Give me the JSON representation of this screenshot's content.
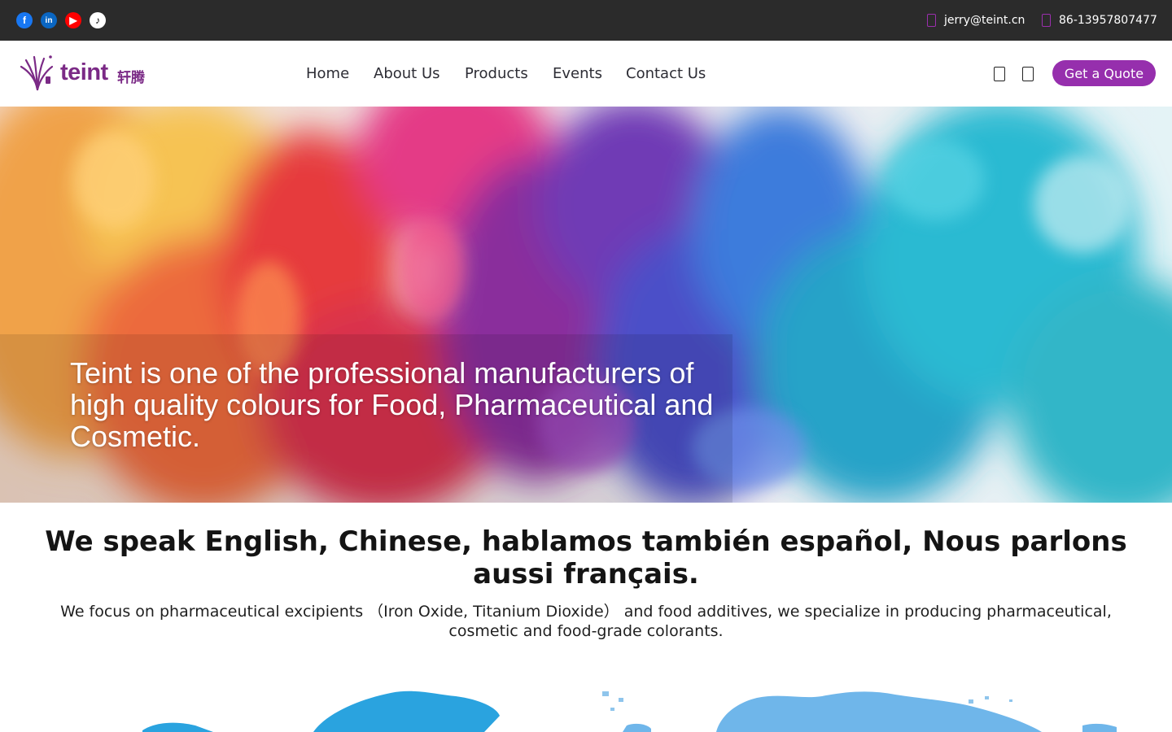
{
  "topbar": {
    "social": [
      {
        "name": "facebook-icon",
        "glyph": "f"
      },
      {
        "name": "linkedin-icon",
        "glyph": "in"
      },
      {
        "name": "youtube-icon",
        "glyph": "▶"
      },
      {
        "name": "tiktok-icon",
        "glyph": "♪"
      }
    ],
    "email": "jerry@teint.cn",
    "phone": "86-13957807477"
  },
  "header": {
    "logo_text": "teint",
    "logo_cn": "轩腾",
    "nav": [
      "Home",
      "About Us",
      "Products",
      "Events",
      "Contact Us"
    ],
    "quote_label": "Get a Quote",
    "icons": [
      "search-icon",
      "language-icon"
    ]
  },
  "hero": {
    "text": "Teint is one of the professional manufacturers of high quality colours for Food, Pharmaceutical and Cosmetic."
  },
  "intro": {
    "headline": "We speak English, Chinese, hablamos también español, Nous parlons aussi français.",
    "subtext": "We focus on pharmaceutical excipients （Iron Oxide, Titanium Dioxide） and food additives, we specialize in producing pharmaceutical, cosmetic and food-grade colorants."
  },
  "colors": {
    "brand": "#962fad",
    "topbar": "#2b2b2b",
    "map_primary": "#2aa3df",
    "map_secondary": "#6fb6ea"
  }
}
